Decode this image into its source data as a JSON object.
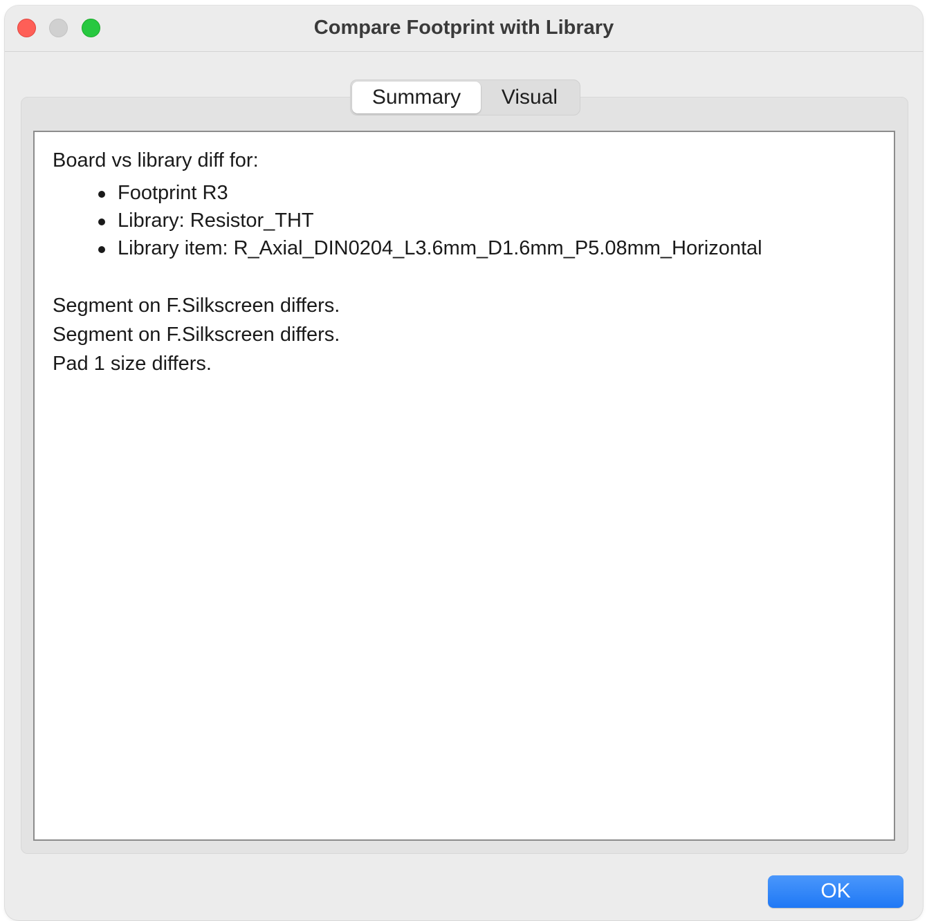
{
  "window": {
    "title": "Compare Footprint with Library"
  },
  "tabs": [
    {
      "label": "Summary",
      "selected": true
    },
    {
      "label": "Visual",
      "selected": false
    }
  ],
  "summary": {
    "heading": "Board vs library diff for:",
    "items": [
      "Footprint R3",
      "Library: Resistor_THT",
      "Library item: R_Axial_DIN0204_L3.6mm_D1.6mm_P5.08mm_Horizontal"
    ],
    "messages": [
      "Segment on F.Silkscreen differs.",
      "Segment on F.Silkscreen differs.",
      "Pad 1 size differs."
    ]
  },
  "buttons": {
    "ok_label": "OK"
  },
  "colors": {
    "accent": "#1f78f5",
    "close": "#fe5f57",
    "zoom": "#27c840"
  }
}
